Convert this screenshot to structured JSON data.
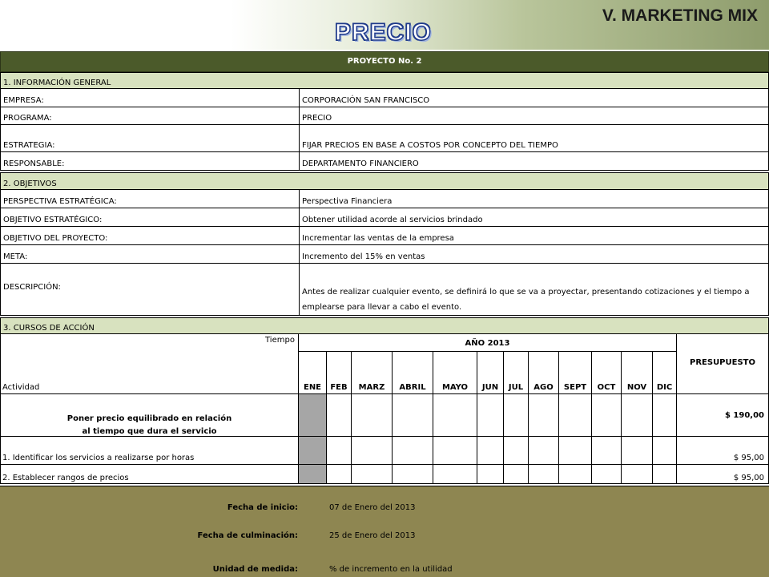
{
  "header": {
    "slide_title": "V. MARKETING MIX",
    "wordart_title": "PRECIO"
  },
  "project_bar": "PROYECTO No. 2",
  "section1": {
    "title": "1. INFORMACIÓN GENERAL",
    "rows": [
      {
        "label": "EMPRESA:",
        "value": "CORPORACIÓN SAN FRANCISCO"
      },
      {
        "label": "PROGRAMA:",
        "value": "PRECIO"
      },
      {
        "label": "ESTRATEGIA:",
        "value": "FIJAR PRECIOS EN BASE A COSTOS POR CONCEPTO DEL TIEMPO"
      },
      {
        "label": "RESPONSABLE:",
        "value": "DEPARTAMENTO FINANCIERO"
      }
    ]
  },
  "section2": {
    "title": "2. OBJETIVOS",
    "rows": [
      {
        "label": "PERSPECTIVA ESTRATÉGICA:",
        "value": "Perspectiva Financiera"
      },
      {
        "label": "OBJETIVO ESTRATÉGICO:",
        "value": "Obtener utilidad acorde al servicios brindado"
      },
      {
        "label": "OBJETIVO DEL PROYECTO:",
        "value": "Incrementar las ventas de la empresa"
      },
      {
        "label": "META:",
        "value": "Incremento del 15% en ventas"
      },
      {
        "label": "DESCRIPCIÓN:",
        "value": "Antes de realizar cualquier evento, se definirá lo que se va a proyectar, presentando cotizaciones y el tiempo a emplearse para llevar a cabo el evento."
      }
    ]
  },
  "section3": {
    "title": "3. CURSOS DE ACCIÓN",
    "tiempo_label": "Tiempo",
    "actividad_label": "Actividad",
    "year_label": "AÑO 2013",
    "budget_label": "PRESUPUESTO",
    "months": [
      "ENE",
      "FEB",
      "MARZ",
      "ABRIL",
      "MAYO",
      "JUN",
      "JUL",
      "AGO",
      "SEPT",
      "OCT",
      "NOV",
      "DIC"
    ],
    "activities": [
      {
        "name_line1": "Poner precio equilibrado  en relación",
        "name_line2": "al tiempo que dura el servicio",
        "budget": "$ 190,00"
      },
      {
        "name": "1. Identificar los servicios a realizarse por horas",
        "budget": "$ 95,00"
      },
      {
        "name": "2. Establecer rangos de precios",
        "budget": "$ 95,00"
      }
    ]
  },
  "footer": {
    "start_label": "Fecha de inicio:",
    "start_value": "07 de Enero del 2013",
    "end_label": "Fecha de culminación:",
    "end_value": "25 de Enero del 2013",
    "unit_label": "Unidad de medida:",
    "unit_value": "% de incremento en la utilidad"
  }
}
